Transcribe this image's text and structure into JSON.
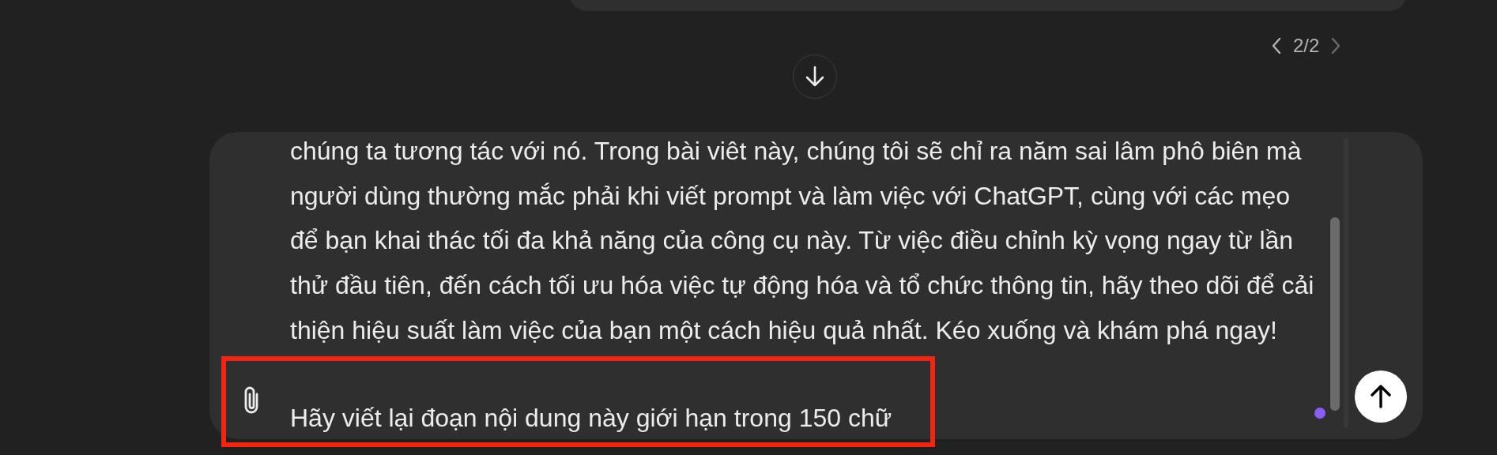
{
  "pager": {
    "label": "2/2"
  },
  "composer": {
    "text": "chúng ta tương tác với nó. Trong bài viêt này, chúng tôi sẽ chỉ ra năm sai lâm phô biên mà người dùng thường mắc phải khi viết prompt và làm việc với ChatGPT, cùng với các mẹo để bạn khai thác tối đa khả năng của công cụ này. Từ việc điều chỉnh kỳ vọng ngay từ lần thử đầu tiên, đến cách tối ưu hóa việc tự động hóa và tổ chức thông tin, hãy theo dõi để cải thiện hiệu suất làm việc của bạn một cách hiệu quả nhất. Kéo xuống và khám phá ngay!",
    "value": "Hãy viết lại đoạn nội dung này giới hạn trong 150 chữ"
  }
}
